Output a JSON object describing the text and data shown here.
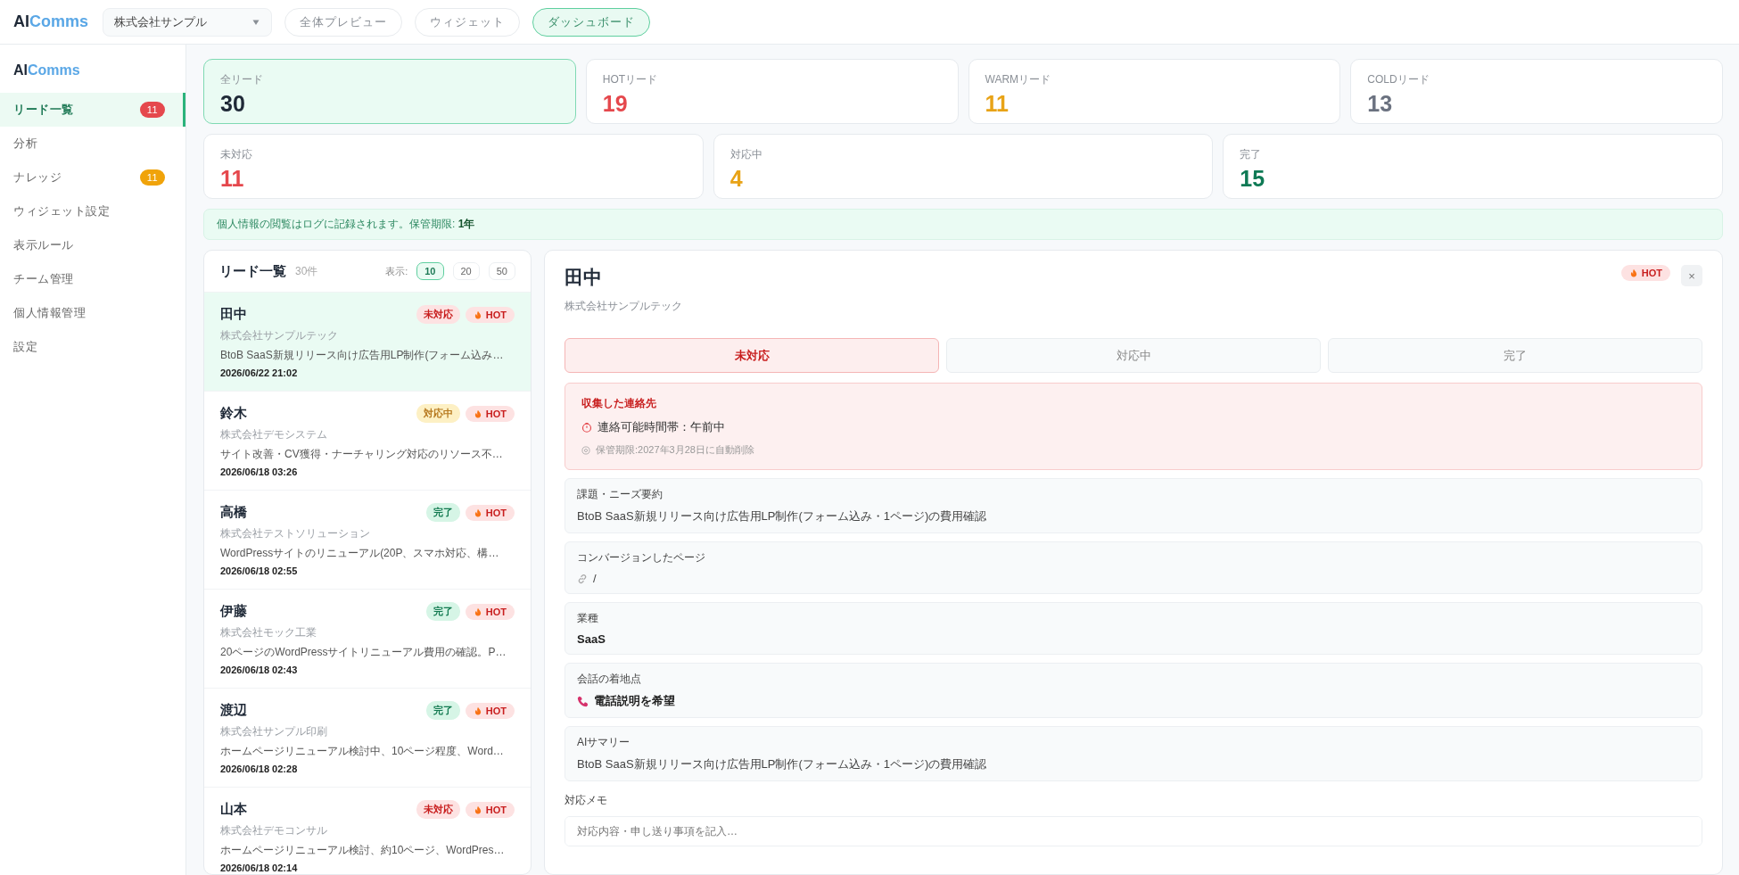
{
  "top_bar": {
    "logo_prefix": "AI",
    "logo_suffix": "Comms",
    "company_select": "株式会社サンプル",
    "nav": [
      {
        "label": "全体プレビュー",
        "selected": false
      },
      {
        "label": "ウィジェット",
        "selected": false
      },
      {
        "label": "ダッシュボード",
        "selected": true
      }
    ]
  },
  "sidebar": {
    "logo_prefix": "AI",
    "logo_suffix": "Comms",
    "items": [
      {
        "label": "リード一覧",
        "selected": true,
        "badge": "11",
        "color": "#e5484d"
      },
      {
        "label": "分析",
        "selected": false
      },
      {
        "label": "ナレッジ",
        "selected": false,
        "badge": "11",
        "color": "#f0a30a"
      },
      {
        "label": "ウィジェット設定",
        "selected": false
      },
      {
        "label": "表示ルール",
        "selected": false
      },
      {
        "label": "チーム管理",
        "selected": false
      },
      {
        "label": "個人情報管理",
        "selected": false
      },
      {
        "label": "設定",
        "selected": false
      }
    ]
  },
  "stat_rows": [
    [
      {
        "label": "全リード",
        "value": "30",
        "color": "#1f2937",
        "selected": true
      },
      {
        "label": "HOTリード",
        "value": "19",
        "color": "#e5484d",
        "selected": false
      },
      {
        "label": "WARMリード",
        "value": "11",
        "color": "#e8a317",
        "selected": false
      },
      {
        "label": "COLDリード",
        "value": "13",
        "color": "#6b7280",
        "selected": false
      }
    ],
    [
      {
        "label": "未対応",
        "value": "11",
        "color": "#e5484d",
        "selected": false
      },
      {
        "label": "対応中",
        "value": "4",
        "color": "#e8a317",
        "selected": false
      },
      {
        "label": "完了",
        "value": "15",
        "color": "#0f7a55",
        "selected": false
      }
    ]
  ],
  "notice": "個人情報の閲覧はログに記録されます。保管期限: **1年**",
  "lead_list": {
    "title": "リード一覧",
    "count": "30件",
    "page_size_label": "表示:",
    "page_sizes": [
      {
        "label": "10",
        "selected": true
      },
      {
        "label": "20",
        "selected": false
      },
      {
        "label": "50",
        "selected": false
      }
    ],
    "leads": [
      {
        "name": "田中",
        "company": "株式会社サンプルテック",
        "summary": "BtoB SaaS新規リリース向け広告用LP制作(フォーム込み…",
        "date": "2026/06/22 21:02",
        "status": {
          "label": "未対応",
          "kind": "new"
        },
        "temperature": "HOT",
        "selected": true
      },
      {
        "name": "鈴木",
        "company": "株式会社デモシステム",
        "summary": "サイト改善・CV獲得・ナーチャリング対応のリソース不…",
        "date": "2026/06/18 03:26",
        "status": {
          "label": "対応中",
          "kind": "progress"
        },
        "temperature": "HOT",
        "selected": false
      },
      {
        "name": "高橋",
        "company": "株式会社テストソリューション",
        "summary": "WordPressサイトのリニューアル(20P、スマホ対応、構…",
        "date": "2026/06/18 02:55",
        "status": {
          "label": "完了",
          "kind": "done"
        },
        "temperature": "HOT",
        "selected": false
      },
      {
        "name": "伊藤",
        "company": "株式会社モック工業",
        "summary": "20ページのWordPressサイトリニューアル費用の確認。P…",
        "date": "2026/06/18 02:43",
        "status": {
          "label": "完了",
          "kind": "done"
        },
        "temperature": "HOT",
        "selected": false
      },
      {
        "name": "渡辺",
        "company": "株式会社サンプル印刷",
        "summary": "ホームページリニューアル検討中、10ページ程度、Word…",
        "date": "2026/06/18 02:28",
        "status": {
          "label": "完了",
          "kind": "done"
        },
        "temperature": "HOT",
        "selected": false
      },
      {
        "name": "山本",
        "company": "株式会社デモコンサル",
        "summary": "ホームページリニューアル検討、約10ページ、WordPres…",
        "date": "2026/06/18 02:14",
        "status": {
          "label": "未対応",
          "kind": "new"
        },
        "temperature": "HOT",
        "selected": false
      }
    ]
  },
  "detail": {
    "name": "田中",
    "company": "株式会社サンプルテック",
    "temperature": "HOT",
    "close": "×",
    "status_tabs": [
      {
        "label": "未対応",
        "selected": true
      },
      {
        "label": "対応中",
        "selected": false
      },
      {
        "label": "完了",
        "selected": false
      }
    ],
    "contact": {
      "title": "収集した連絡先",
      "availability": "連絡可能時間帯：午前中",
      "retention": "保管期限:2027年3月28日に自動削除"
    },
    "fields": [
      {
        "label": "課題・ニーズ要約",
        "value": "BtoB SaaS新規リリース向け広告用LP制作(フォーム込み・1ページ)の費用確認",
        "kind": "text"
      },
      {
        "label": "コンバージョンしたページ",
        "value": "/",
        "kind": "link"
      },
      {
        "label": "業種",
        "value": "SaaS",
        "kind": "strong"
      },
      {
        "label": "会話の着地点",
        "value": "電話説明を希望",
        "kind": "phone"
      },
      {
        "label": "AIサマリー",
        "value": "BtoB SaaS新規リリース向け広告用LP制作(フォーム込み・1ページ)の費用確認",
        "kind": "text"
      }
    ],
    "memo": {
      "label": "対応メモ",
      "placeholder": "対応内容・申し送り事項を記入…"
    }
  }
}
